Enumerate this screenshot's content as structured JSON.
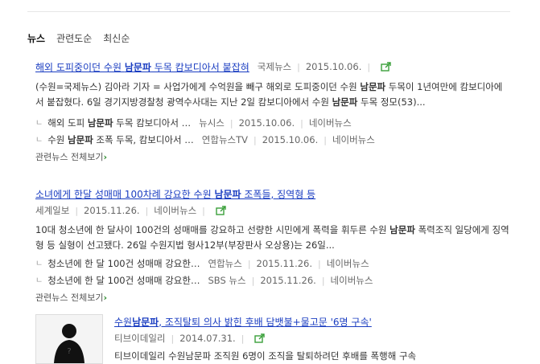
{
  "tabs": [
    "뉴스",
    "관련도순",
    "최신순"
  ],
  "more_label": "관련뉴스 전체보기",
  "articles": [
    {
      "title_pre": "해외 도피중이던 수원 ",
      "title_hl": "남문파",
      "title_post": " 두목 캄보디아서 붙잡혀",
      "source": "국제뉴스",
      "date": "2015.10.06.",
      "desc_pre": "(수원=국제뉴스) 김아라 기자 = 사업가에게 수억원을 빼구 해외로 도피중이던 수원 ",
      "desc_hl": "남문파",
      "desc_mid": " 두목이 1년여만에 캄보디아에서 붙잡혔다. 6일 경기지방경찰청 광역수사대는 지난 2일 캄보디아에서 수원 ",
      "desc_hl2": "남문파",
      "desc_post": " 두목 정모(53)...",
      "related": [
        {
          "pre": "해외 도피 ",
          "hl": "남문파",
          "post": " 두목 캄보디아서 …",
          "source": "뉴시스",
          "date": "2015.10.06.",
          "portal": "네이버뉴스"
        },
        {
          "pre": "수원 ",
          "hl": "남문파",
          "post": " 조폭 두목, 캄보디아서 …",
          "source": "연합뉴스TV",
          "date": "2015.10.06.",
          "portal": "네이버뉴스"
        }
      ]
    },
    {
      "title_pre": "소녀에게 한달 성매매 100차례 강요한 수원 ",
      "title_hl": "남문파",
      "title_post": " 조폭들, 징역형 등",
      "source": "세계일보",
      "date": "2015.11.26.",
      "portal": "네이버뉴스",
      "desc_pre": "10대 청소년에 한 달사이 100건의 성매매를 강요하고 선량한 시민에게 폭력을 휘두른 수원 ",
      "desc_hl": "남문파",
      "desc_post": " 폭력조직 일당에게 징역형 등 실형이 선고됐다. 26일 수원지법 형사12부(부장판사 오상용)는 26일...",
      "related": [
        {
          "text": "청소년에 한 달 100건 성매매 강요한…",
          "source": "연합뉴스",
          "date": "2015.11.26.",
          "portal": "네이버뉴스"
        },
        {
          "text": "청소년에 한 달 100건 성매매 강요한…",
          "source": "SBS 뉴스",
          "date": "2015.11.26.",
          "portal": "네이버뉴스"
        }
      ]
    },
    {
      "title_pre": "수원",
      "title_hl": "남문파",
      "title_post": ", 조직탈퇴 의사 밝힌 후배 담뱃불+물고문 '6명 구속'",
      "source": "티브이데일리",
      "date": "2014.07.31.",
      "desc_fragment": "티브이데일리 수원남문파 조직원 6명이 조직을 탈퇴하려던 후배를 폭행해 구속"
    }
  ],
  "colors": {
    "link": "#1a3dc1",
    "share": "#3aa03a"
  }
}
